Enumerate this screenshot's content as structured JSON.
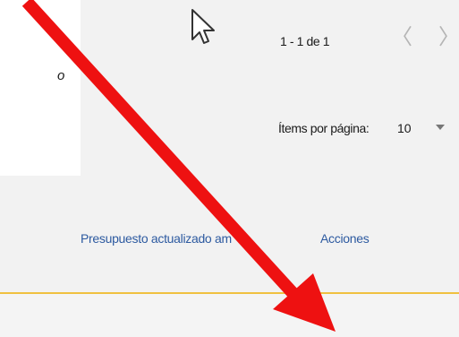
{
  "card": {
    "text_fragment": "o"
  },
  "pagination": {
    "range_label": "1 - 1 de 1",
    "prev_icon": "chevron-left-icon",
    "next_icon": "chevron-right-icon",
    "prev_glyph": "〈",
    "next_glyph": "〉",
    "items_per_page_label": "Ítems por página:",
    "items_per_page_value": "10"
  },
  "table": {
    "columns": [
      {
        "label": "Presupuesto actualizado am"
      },
      {
        "label": "Acciones"
      }
    ]
  },
  "colors": {
    "accent_line": "#f0c040",
    "link_blue": "#2d5aa0",
    "annotation_red": "#ee1111"
  },
  "overlay": {
    "cursor_icon": "mouse-pointer-icon",
    "annotation_icon": "red-arrow-icon"
  }
}
